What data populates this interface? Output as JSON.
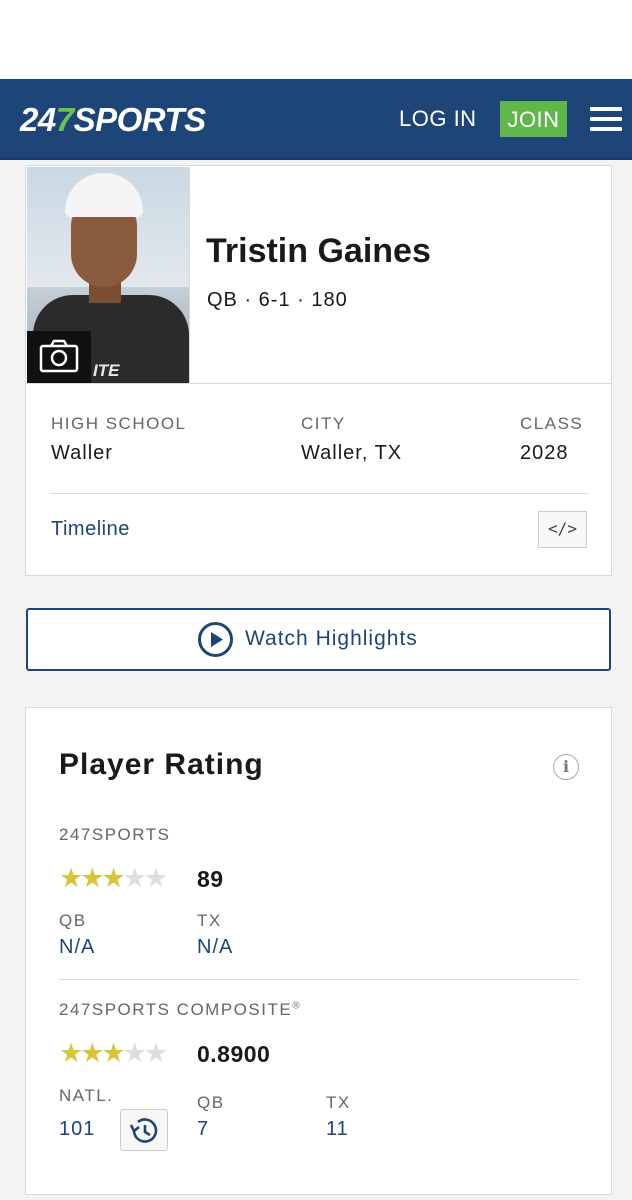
{
  "header": {
    "logo_num_a": "24",
    "logo_num_b": "7",
    "logo_word": "SPORTS",
    "login_label": "LOG IN",
    "join_label": "JOIN",
    "colors": {
      "nav_bg": "#1e4577",
      "join_bg": "#5fb64a",
      "logo_accent": "#6cc24a"
    }
  },
  "profile": {
    "name": "Tristin Gaines",
    "meta": "QB · 6-1 · 180",
    "photo_jersey_text": "ITE",
    "high_school_label": "HIGH SCHOOL",
    "high_school_value": "Waller",
    "city_label": "CITY",
    "city_value": "Waller, TX",
    "class_label": "CLASS",
    "class_value": "2028",
    "timeline_label": "Timeline",
    "embed_label": "</>",
    "camera_icon": "camera-icon"
  },
  "highlights": {
    "label": "Watch Highlights",
    "icon": "play-circle-icon"
  },
  "rating": {
    "title": "Player Rating",
    "info_label": "i",
    "sports247": {
      "label": "247SPORTS",
      "stars": 3,
      "stars_max": 5,
      "score": "89",
      "position_label": "QB",
      "position_value": "N/A",
      "state_label": "TX",
      "state_value": "N/A"
    },
    "composite": {
      "label": "247SPORTS COMPOSITE",
      "label_mark": "®",
      "stars": 3,
      "stars_max": 5,
      "score": "0.8900",
      "natl_label": "NATL.",
      "natl_value": "101",
      "position_label": "QB",
      "position_value": "7",
      "state_label": "TX",
      "state_value": "11",
      "history_icon": "history-icon"
    },
    "colors": {
      "star_on": "#d8c53a",
      "star_off": "#dedede",
      "link": "#1e4577"
    }
  }
}
